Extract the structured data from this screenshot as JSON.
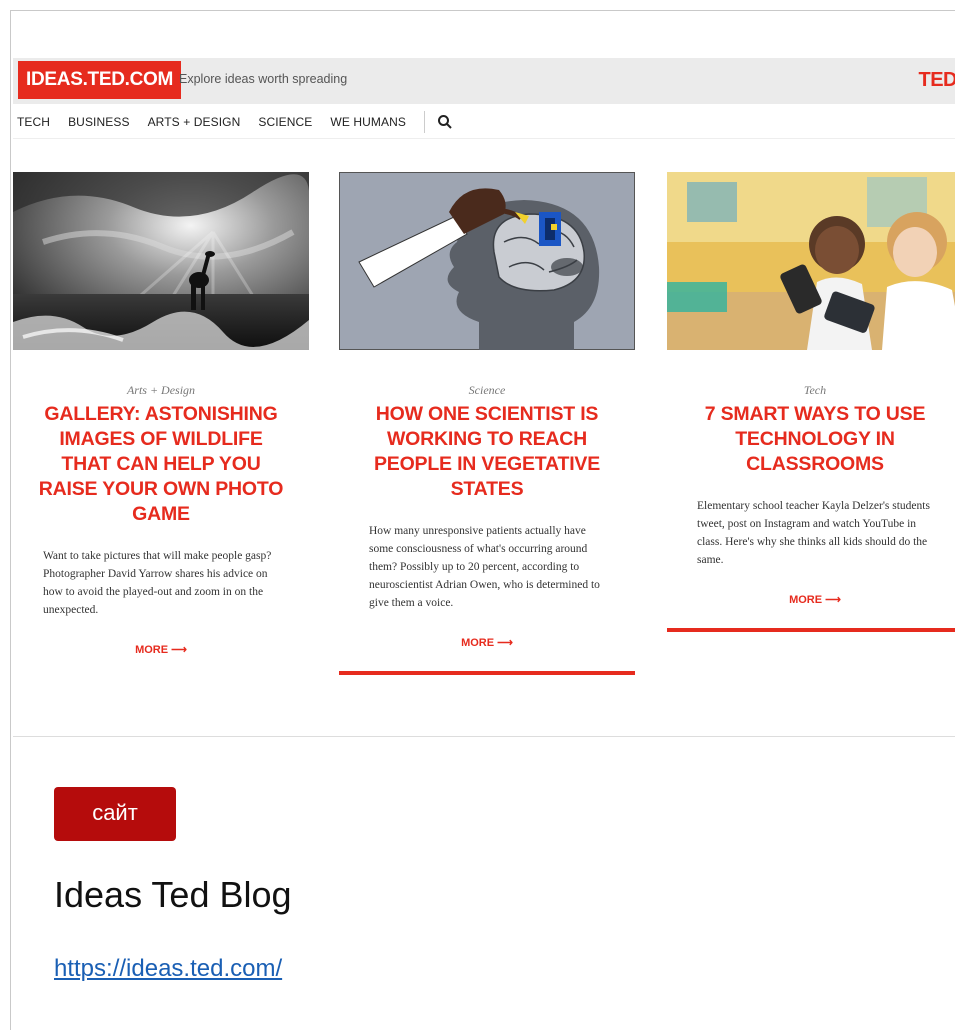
{
  "site": {
    "logo": "IDEAS.TED.COM",
    "tagline": "Explore ideas worth spreading",
    "brand": "TED"
  },
  "nav": {
    "items": [
      "TECH",
      "BUSINESS",
      "ARTS + DESIGN",
      "SCIENCE",
      "WE HUMANS"
    ]
  },
  "articles": [
    {
      "category": "Arts + Design",
      "headline": "GALLERY: ASTONISHING IMAGES OF WILDLIFE THAT CAN HELP YOU RAISE YOUR OWN PHOTO GAME",
      "description": "Want to take pictures that will make people gasp? Photographer David Yarrow shares his advice on how to avoid the played-out and zoom in on the unexpected.",
      "more": "MORE ⟶"
    },
    {
      "category": "Science",
      "headline": "HOW ONE SCIENTIST IS WORKING TO REACH PEOPLE IN VEGETATIVE STATES",
      "description": "How many unresponsive patients actually have some consciousness of what's occurring around them? Possibly up to 20 percent, according to neuroscientist Adrian Owen, who is determined to give them a voice.",
      "more": "MORE ⟶"
    },
    {
      "category": "Tech",
      "headline": "7 SMART WAYS TO USE TECHNOLOGY IN CLASSROOMS",
      "description": "Elementary school teacher Kayla Delzer's students tweet, post on Instagram and watch YouTube in class. Here's why she thinks all kids should do the same.",
      "more": "MORE ⟶"
    }
  ],
  "card": {
    "badge": "сайт",
    "title": "Ideas Ted Blog",
    "url": "https://ideas.ted.com/"
  },
  "colors": {
    "ted_red": "#e62b1e",
    "badge_red": "#b50c0c",
    "link_blue": "#1a5fb4"
  }
}
